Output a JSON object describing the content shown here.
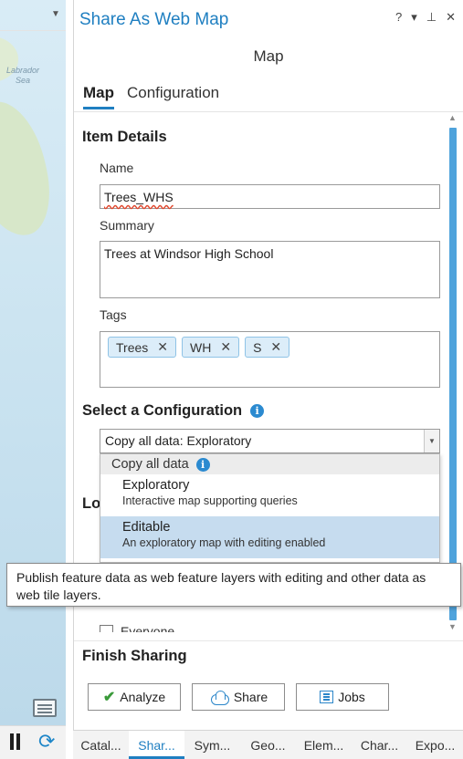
{
  "map": {
    "label": "Labrador Sea"
  },
  "pane": {
    "title": "Share As Web Map",
    "controls": [
      "?",
      "▾",
      "📌",
      "✕"
    ],
    "subtitle": "Map",
    "tabs": [
      {
        "label": "Map",
        "active": true
      },
      {
        "label": "Configuration",
        "active": false
      }
    ]
  },
  "item_details": {
    "heading": "Item Details",
    "name_label": "Name",
    "name_value": "Trees_WHS",
    "summary_label": "Summary",
    "summary_value": "Trees at Windsor High School",
    "tags_label": "Tags",
    "tags": [
      "Trees",
      "WH",
      "S"
    ]
  },
  "configuration": {
    "heading": "Select a Configuration",
    "selected": "Copy all data: Exploratory",
    "group": "Copy all data",
    "options": [
      {
        "title": "Exploratory",
        "desc": "Interactive map supporting queries"
      },
      {
        "title": "Editable",
        "desc": "An exploratory map with editing enabled",
        "selected": true
      }
    ]
  },
  "partial_section": "Lo",
  "checkbox_everyone": "Everyone",
  "tooltip": "Publish feature data as web feature layers with editing and other data as web tile layers.",
  "finish": {
    "heading": "Finish Sharing",
    "buttons": {
      "analyze": "Analyze",
      "share": "Share",
      "jobs": "Jobs"
    }
  },
  "bottom_tabs": [
    "Catal...",
    "Shar...",
    "Sym...",
    "Geo...",
    "Elem...",
    "Char...",
    "Expo..."
  ],
  "colors": {
    "accent": "#1f7fc1",
    "selection": "#c6dcef",
    "scrollbar": "#4fa3dc"
  }
}
